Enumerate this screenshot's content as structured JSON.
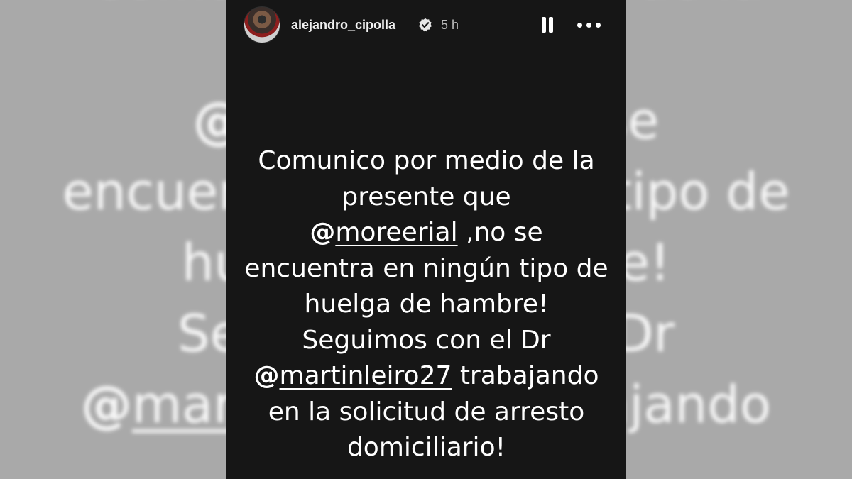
{
  "background": {
    "lines": [
      "Comunico por medio de la",
      "presente que",
      "@moreerial ,no se",
      "encuentra en ningún tipo de",
      "huelga de hambre!",
      "Seguimos con el Dr",
      "@martinleiro27 trabajando"
    ]
  },
  "story": {
    "username": "alejandro_cipolla",
    "time": "5 h",
    "verified": true,
    "avatar": "profile-photo",
    "message": {
      "line1": "Comunico por medio de la",
      "line2": "presente que",
      "mention1": "moreerial",
      "line3_rest": " ,no se",
      "line4": "encuentra en ningún tipo de",
      "line5": "huelga de hambre!",
      "line6": "Seguimos con el Dr",
      "mention2": "martinleiro27",
      "line7_rest": " trabajando",
      "line8": "en la solicitud de arresto",
      "line9": "domiciliario!"
    },
    "mention_icon": "threads-at-icon",
    "controls": {
      "pause_icon": "pause-icon",
      "more_icon": "more-options-icon"
    },
    "colors": {
      "panel": "#161616",
      "text": "#ffffff",
      "background": "#a9a9a9"
    }
  }
}
